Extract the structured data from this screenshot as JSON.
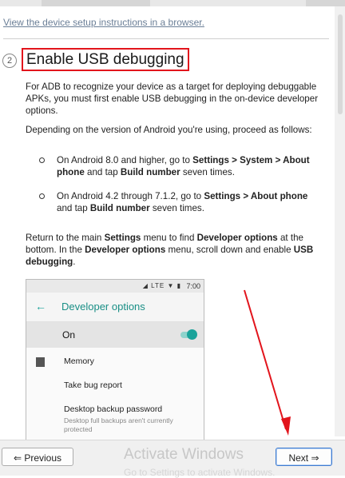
{
  "browser_link": "View the device setup instructions in a browser.",
  "step": {
    "number": "2",
    "title": "Enable USB debugging"
  },
  "paragraph1": {
    "text": "For ADB to recognize your device as a target for deploying debuggable APKs, you must first enable USB debugging in the on-device developer options."
  },
  "paragraph2": {
    "text": "Depending on the version of Android you're using, proceed as follows:"
  },
  "bullets": [
    {
      "pre": "On Android 8.0 and higher, go to ",
      "bold1": "Settings > System > About phone",
      "mid": " and tap ",
      "bold2": "Build number",
      "post": " seven times."
    },
    {
      "pre": "On Android 4.2 through 7.1.2, go to ",
      "bold1": "Settings > About phone",
      "mid": " and tap ",
      "bold2": "Build number",
      "post": " seven times."
    }
  ],
  "paragraph3": {
    "pre": "Return to the main ",
    "b1": "Settings",
    "t2": " menu to find ",
    "b2": "Developer options",
    "t3": " at the bottom. In the ",
    "b3": "Developer options",
    "t4": " menu, scroll down and enable ",
    "b4": "USB debugging",
    "t5": "."
  },
  "phone": {
    "status_icons": "LTE",
    "time": "7:00",
    "title": "Developer options",
    "on_label": "On",
    "toggle_on": true,
    "items": [
      {
        "label": "Memory"
      },
      {
        "label": "Take bug report"
      },
      {
        "label": "Desktop backup password"
      }
    ],
    "desktop_sub": "Desktop full backups aren't currently protected"
  },
  "footer": {
    "previous": "Previous",
    "next": "Next",
    "watermark": "Activate Windows",
    "watermark_sub": "Go to Settings to activate Windows."
  },
  "colors": {
    "highlight_border": "#e2141c",
    "accent_teal": "#1aa39a",
    "arrow": "#e2141c"
  }
}
